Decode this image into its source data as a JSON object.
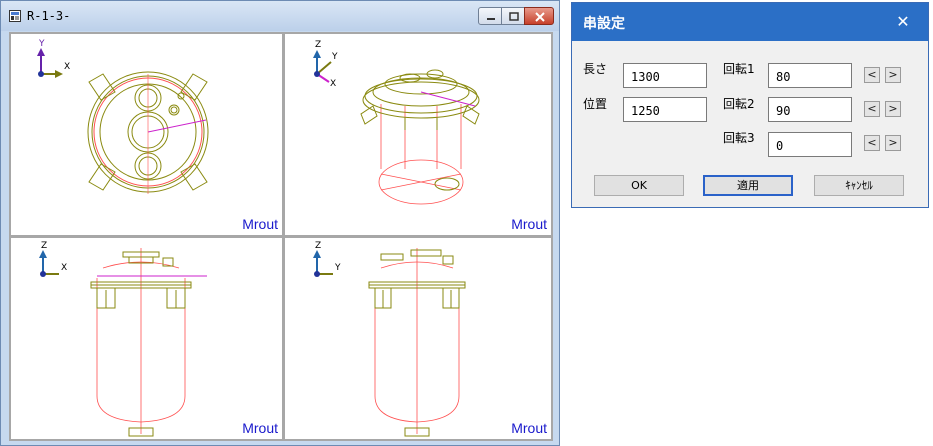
{
  "cad_window": {
    "title": "R-1-3-",
    "viewports": [
      {
        "name": "top-view",
        "axis_v": "Y",
        "axis_h": "X",
        "label": "Mrout"
      },
      {
        "name": "iso-view",
        "axis_v": "Z",
        "axis_h": "Y",
        "axis_d": "X",
        "label": "Mrout"
      },
      {
        "name": "front-view",
        "axis_v": "Z",
        "axis_h": "X",
        "label": "Mrout"
      },
      {
        "name": "side-view",
        "axis_v": "Z",
        "axis_h": "Y",
        "label": "Mrout"
      }
    ]
  },
  "dialog": {
    "title": "串設定",
    "close_glyph": "✕",
    "length_label": "長さ",
    "length_value": "1300",
    "position_label": "位置",
    "position_value": "1250",
    "rot1_label": "回転1",
    "rot1_value": "80",
    "rot2_label": "回転2",
    "rot2_value": "90",
    "rot3_label": "回転3",
    "rot3_value": "0",
    "arrow_left": "<",
    "arrow_right": ">",
    "ok_label": "OK",
    "apply_label": "適用",
    "cancel_label": "ｷｬﾝｾﾙ"
  },
  "colors": {
    "equipment": "#8a8a10",
    "red_lines": "#ff5050",
    "skewer": "#cc22cc",
    "label_blue": "#1a1acc",
    "dialog_title_bg": "#2b6fc6"
  }
}
